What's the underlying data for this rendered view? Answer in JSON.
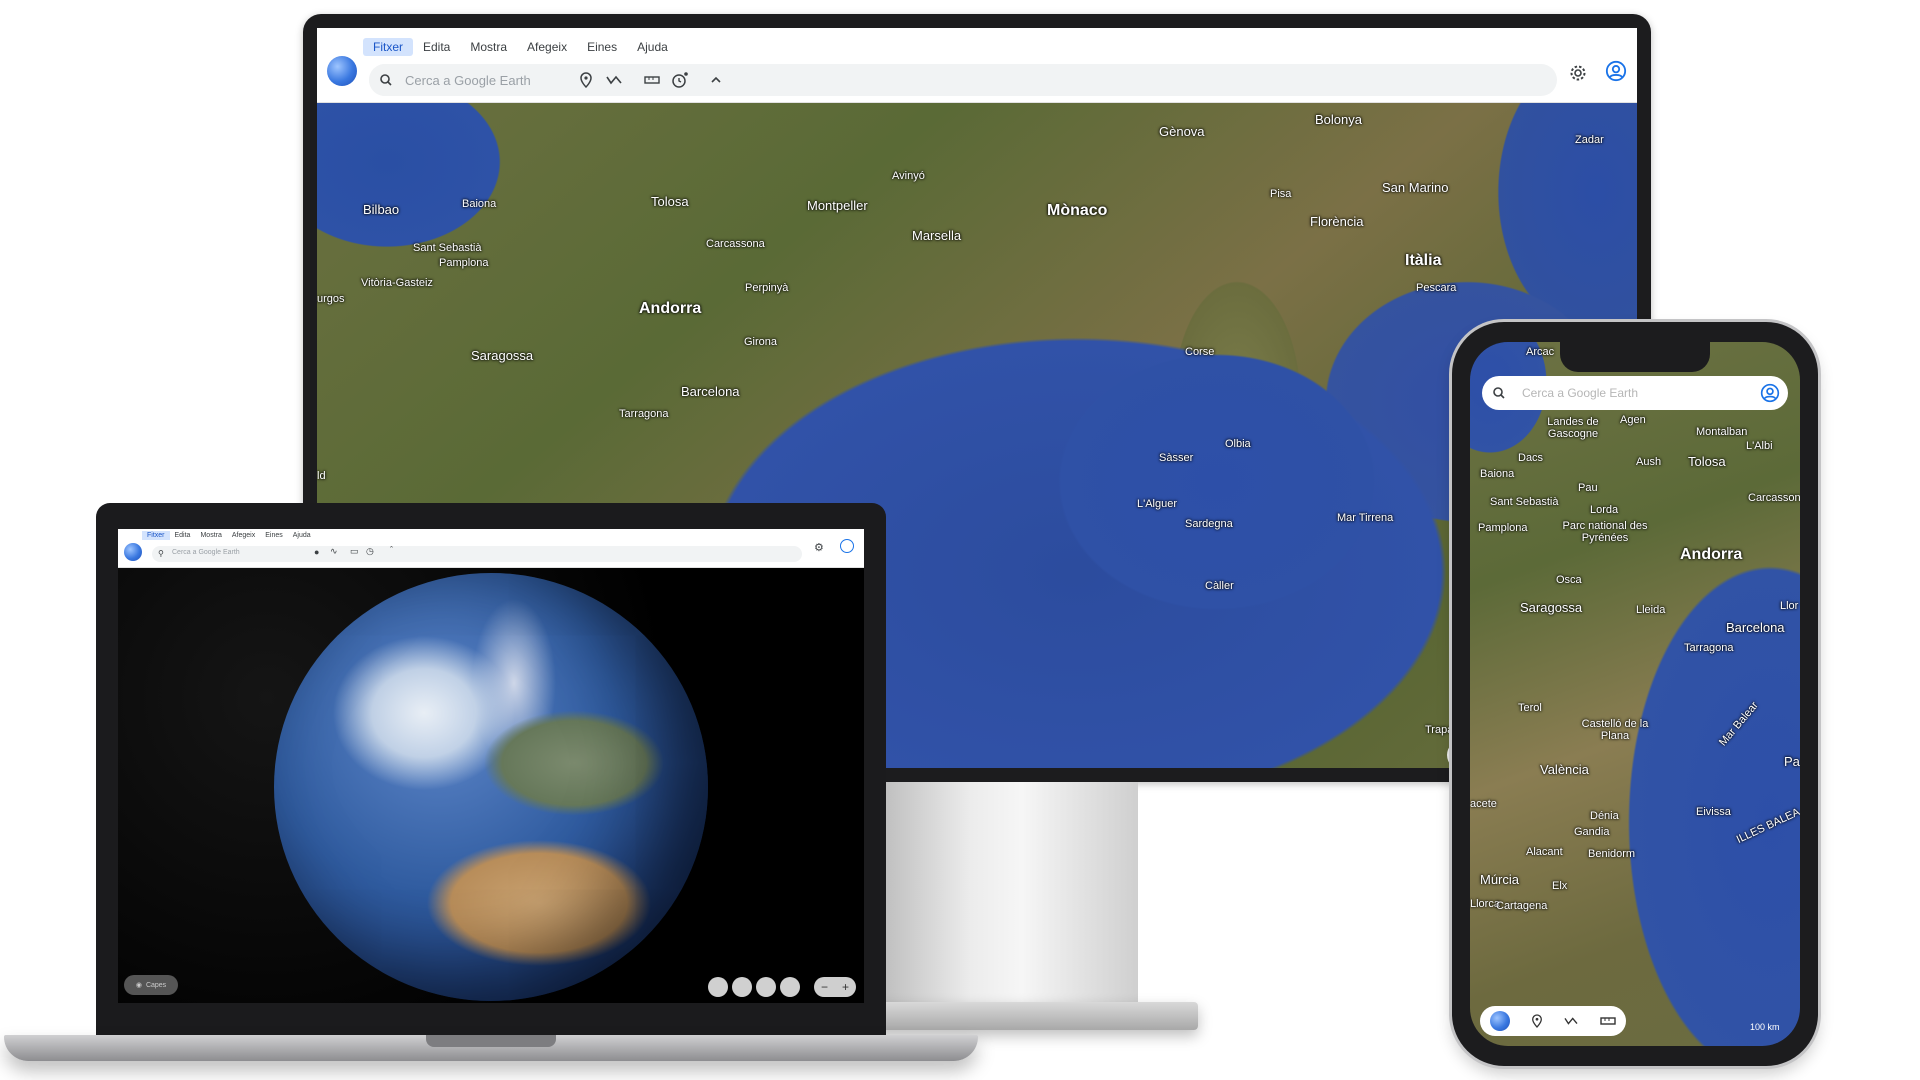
{
  "desktop": {
    "menu": [
      "Fitxer",
      "Edita",
      "Mostra",
      "Afegeix",
      "Eines",
      "Ajuda"
    ],
    "search_placeholder": "Cerca a Google Earth",
    "map_labels": [
      {
        "text": "Gènova",
        "size": "m"
      },
      {
        "text": "Bolonya",
        "size": "m"
      },
      {
        "text": "Zadar",
        "size": "s"
      },
      {
        "text": "Bilbao",
        "size": "m"
      },
      {
        "text": "Baiona",
        "size": "s"
      },
      {
        "text": "Tolosa",
        "size": "m"
      },
      {
        "text": "Avinyó",
        "size": "s"
      },
      {
        "text": "Montpeller",
        "size": "m"
      },
      {
        "text": "Mònaco",
        "size": "l"
      },
      {
        "text": "Pisa",
        "size": "s"
      },
      {
        "text": "San Marino",
        "size": "m"
      },
      {
        "text": "Florència",
        "size": "m"
      },
      {
        "text": "Sant Sebastià",
        "size": "s"
      },
      {
        "text": "Carcassona",
        "size": "s"
      },
      {
        "text": "Marsella",
        "size": "m"
      },
      {
        "text": "Itàlia",
        "size": "l"
      },
      {
        "text": "Pamplona",
        "size": "s"
      },
      {
        "text": "Vitòria-Gasteiz",
        "size": "s"
      },
      {
        "text": "Perpinyà",
        "size": "s"
      },
      {
        "text": "Pescara",
        "size": "s"
      },
      {
        "text": "Andorra",
        "size": "l"
      },
      {
        "text": "Corse",
        "size": "s"
      },
      {
        "text": "Saragossa",
        "size": "m"
      },
      {
        "text": "Girona",
        "size": "s"
      },
      {
        "text": "Barcelona",
        "size": "m"
      },
      {
        "text": "Tarragona",
        "size": "s"
      },
      {
        "text": "Olbia",
        "size": "s"
      },
      {
        "text": "Sàsser",
        "size": "s"
      },
      {
        "text": "L'Alguer",
        "size": "s"
      },
      {
        "text": "Mar Tirrena",
        "size": "s"
      },
      {
        "text": "Sardegna",
        "size": "s"
      },
      {
        "text": "Càller",
        "size": "s"
      },
      {
        "text": "Trapani",
        "size": "s"
      },
      {
        "text": "urgos",
        "size": "s"
      },
      {
        "text": "ld",
        "size": "s"
      },
      {
        "text": "R",
        "size": "m"
      }
    ]
  },
  "laptop": {
    "menu": [
      "Fitxer",
      "Edita",
      "Mostra",
      "Afegeix",
      "Eines",
      "Ajuda"
    ],
    "search_placeholder": "Cerca a Google Earth",
    "layers_label": "Capes"
  },
  "phone": {
    "search_placeholder": "Cerca a Google Earth",
    "scale": "100 km",
    "map_labels": [
      {
        "text": "Arcac",
        "size": "s"
      },
      {
        "text": "Landes de Gascogne",
        "size": "s"
      },
      {
        "text": "Agen",
        "size": "s"
      },
      {
        "text": "Montalban",
        "size": "s"
      },
      {
        "text": "Dacs",
        "size": "s"
      },
      {
        "text": "L'Albi",
        "size": "s"
      },
      {
        "text": "Aush",
        "size": "s"
      },
      {
        "text": "Tolosa",
        "size": "m"
      },
      {
        "text": "Baiona",
        "size": "s"
      },
      {
        "text": "Pau",
        "size": "s"
      },
      {
        "text": "Sant Sebastià",
        "size": "s"
      },
      {
        "text": "Carcassona",
        "size": "s"
      },
      {
        "text": "Lorda",
        "size": "s"
      },
      {
        "text": "Pamplona",
        "size": "s"
      },
      {
        "text": "Parc national des Pyrénées",
        "size": "s"
      },
      {
        "text": "Andorra",
        "size": "l"
      },
      {
        "text": "Osca",
        "size": "s"
      },
      {
        "text": "Saragossa",
        "size": "m"
      },
      {
        "text": "Lleida",
        "size": "s"
      },
      {
        "text": "Llor",
        "size": "s"
      },
      {
        "text": "Barcelona",
        "size": "m"
      },
      {
        "text": "Tarragona",
        "size": "s"
      },
      {
        "text": "Terol",
        "size": "s"
      },
      {
        "text": "Castelló de la Plana",
        "size": "s"
      },
      {
        "text": "Mar Balear",
        "size": "s"
      },
      {
        "text": "València",
        "size": "m"
      },
      {
        "text": "Pa",
        "size": "m"
      },
      {
        "text": "acete",
        "size": "s"
      },
      {
        "text": "Dénia",
        "size": "s"
      },
      {
        "text": "Eivissa",
        "size": "s"
      },
      {
        "text": "Gandia",
        "size": "s"
      },
      {
        "text": "ILLES BALEA",
        "size": "s"
      },
      {
        "text": "Alacant",
        "size": "s"
      },
      {
        "text": "Benidorm",
        "size": "s"
      },
      {
        "text": "Múrcia",
        "size": "m"
      },
      {
        "text": "Elx",
        "size": "s"
      },
      {
        "text": "Llorca",
        "size": "s"
      },
      {
        "text": "Cartagena",
        "size": "s"
      }
    ]
  }
}
